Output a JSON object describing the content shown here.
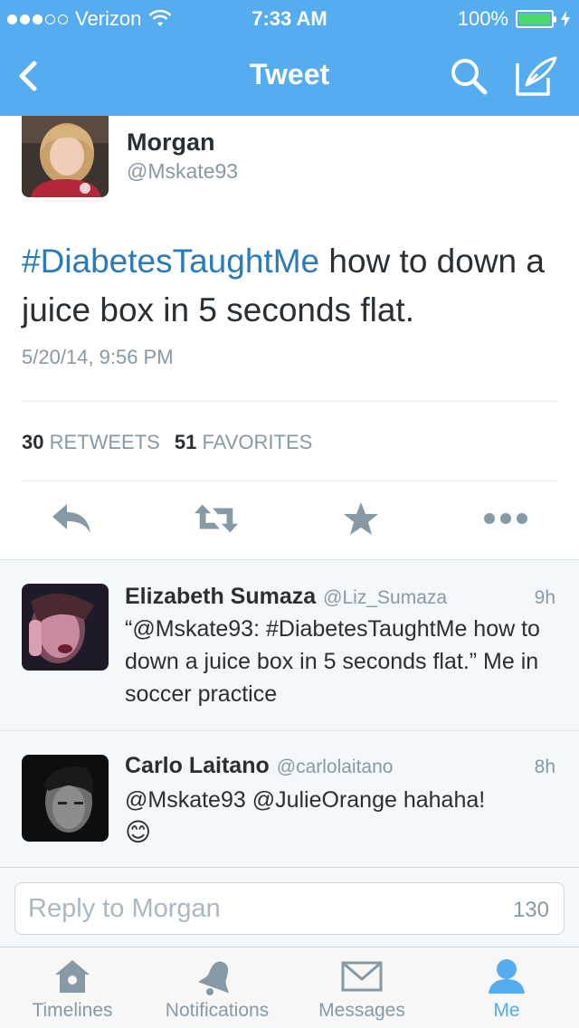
{
  "status_bar": {
    "carrier": "Verizon",
    "time": "7:33 AM",
    "battery": "100%",
    "signal_bars_filled": 3,
    "signal_bars_total": 5
  },
  "nav": {
    "title": "Tweet",
    "back_icon": "chevron-left-icon",
    "search_icon": "search-icon",
    "compose_icon": "compose-icon"
  },
  "tweet": {
    "author_name": "Morgan",
    "author_handle": "@Mskate93",
    "hashtag": "#DiabetesTaughtMe",
    "text_rest": " how to down a juice box in 5 seconds flat.",
    "timestamp": "5/20/14, 9:56 PM",
    "retweets_count": "30",
    "retweets_label": "RETWEETS",
    "favorites_count": "51",
    "favorites_label": "FAVORITES"
  },
  "actions": [
    {
      "name": "reply-icon"
    },
    {
      "name": "retweet-icon"
    },
    {
      "name": "favorite-star-icon"
    },
    {
      "name": "more-icon"
    }
  ],
  "replies": [
    {
      "name": "Elizabeth Sumaza",
      "handle": "@Liz_Sumaza",
      "time": "9h",
      "text": "“@Mskate93: #DiabetesTaughtMe how to down a juice box in 5 seconds flat.” Me in soccer practice"
    },
    {
      "name": "Carlo Laitano",
      "handle": "@carlolaitano",
      "time": "8h",
      "text": "@Mskate93 @JulieOrange hahaha!",
      "emoji": "😊"
    }
  ],
  "reply_box": {
    "placeholder": "Reply to Morgan",
    "char_count": "130"
  },
  "tabs": [
    {
      "label": "Timelines",
      "icon": "home-icon",
      "active": false
    },
    {
      "label": "Notifications",
      "icon": "bell-icon",
      "active": false
    },
    {
      "label": "Messages",
      "icon": "envelope-icon",
      "active": false
    },
    {
      "label": "Me",
      "icon": "person-icon",
      "active": true
    }
  ],
  "colors": {
    "brand_blue": "#55acee",
    "hashtag_blue": "#2b7bb9",
    "battery_green": "#4cd964",
    "muted_text": "#8899a6"
  }
}
